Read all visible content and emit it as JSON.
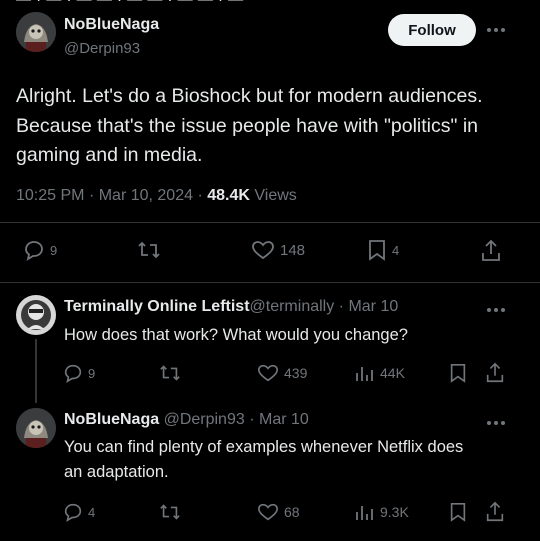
{
  "main_tweet": {
    "display_name": "NoBlueNaga",
    "handle": "@Derpin93",
    "follow_label": "Follow",
    "text": "Alright. Let's do a Bioshock but for modern audiences. Because that's the issue people have with \"politics\" in gaming and in media.",
    "time": "10:25 PM",
    "date": "Mar 10, 2024",
    "views_count": "48.4K",
    "views_label": "Views",
    "sep": "·",
    "stats": {
      "replies": "9",
      "likes": "148",
      "bookmarks": "4"
    }
  },
  "replies": [
    {
      "display_name": "Terminally Online Leftist",
      "handle": "@terminally",
      "date": "Mar 10",
      "sep": "·",
      "text": "How does that work? What would you change?",
      "stats": {
        "replies": "9",
        "likes": "439",
        "views": "44K"
      }
    },
    {
      "display_name": "NoBlueNaga",
      "handle": "@Derpin93",
      "date": "Mar 10",
      "sep": "·",
      "text": "You can find plenty of examples whenever Netflix does an adaptation.",
      "stats": {
        "replies": "4",
        "likes": "68",
        "views": "9.3K"
      }
    }
  ],
  "icons": [
    "more-icon",
    "reply-icon",
    "retweet-icon",
    "like-icon",
    "bookmark-icon",
    "share-icon",
    "views-icon"
  ],
  "colors": {
    "background": "#000000",
    "text": "#e7e9ea",
    "muted": "#71767b",
    "follow_bg": "#eff3f4",
    "divider": "#2f3336"
  }
}
